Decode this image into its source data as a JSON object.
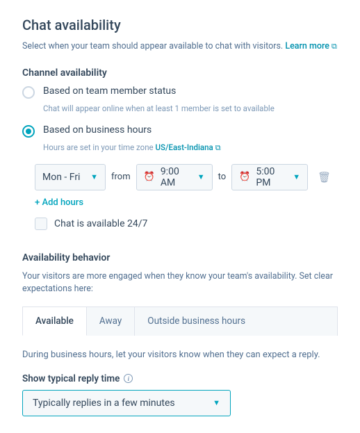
{
  "header": {
    "title": "Chat availability",
    "subtitle": "Select when your team should appear available to chat with visitors.",
    "learn_more": "Learn more"
  },
  "channel": {
    "heading": "Channel availability",
    "opt_member": {
      "label": "Based on team member status",
      "help": "Chat will appear online when at least 1 member is set to available"
    },
    "opt_hours": {
      "label": "Based on business hours",
      "help_prefix": "Hours are set in your time zone ",
      "timezone": "US/East-Indiana"
    },
    "schedule": {
      "days": "Mon - Fri",
      "from_label": "from",
      "start": "9:00 AM",
      "to_label": "to",
      "end": "5:00 PM"
    },
    "add_hours": "+ Add hours",
    "always_label": "Chat is available 24/7"
  },
  "behavior": {
    "heading": "Availability behavior",
    "desc": "Your visitors are more engaged when they know your team's availability. Set clear expectations here:",
    "tabs": {
      "available": "Available",
      "away": "Away",
      "outside": "Outside business hours"
    },
    "tab_desc": "During business hours, let your visitors know when they can expect a reply.",
    "reply_label": "Show typical reply time",
    "reply_value": "Typically replies in a few minutes"
  }
}
